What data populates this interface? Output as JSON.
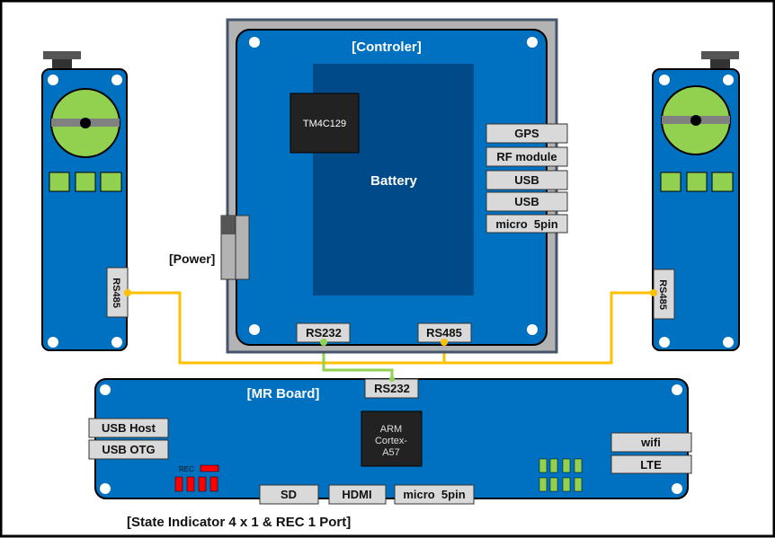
{
  "controller": {
    "title": "[Controler]",
    "chip": "TM4C129",
    "battery": "Battery",
    "ports_right": [
      "GPS",
      "RF module",
      "USB",
      "USB",
      "micro  5pin"
    ],
    "port_rs232": "RS232",
    "port_rs485": "RS485",
    "power_label": "[Power]"
  },
  "servo_left": {
    "port": "RS485"
  },
  "servo_right": {
    "port": "RS485"
  },
  "mr_board": {
    "title": "[MR Board]",
    "port_rs232": "RS232",
    "chip_lines": [
      "ARM",
      "Cortex-",
      "A57"
    ],
    "ports_left": [
      "USB Host",
      "USB OTG"
    ],
    "ports_bottom": [
      "SD",
      "HDMI",
      "micro  5pin"
    ],
    "ports_right": [
      "wifi",
      "LTE"
    ],
    "rec_label": "REC"
  },
  "caption": "[State Indicator 4 x 1 & REC 1 Port]",
  "colors": {
    "board": "#0070c0",
    "battery": "#004a8a",
    "rs485_line": "#ffc000",
    "rs232_line": "#92d050",
    "led_green": "#92d050",
    "led_red": "#ff0000"
  }
}
